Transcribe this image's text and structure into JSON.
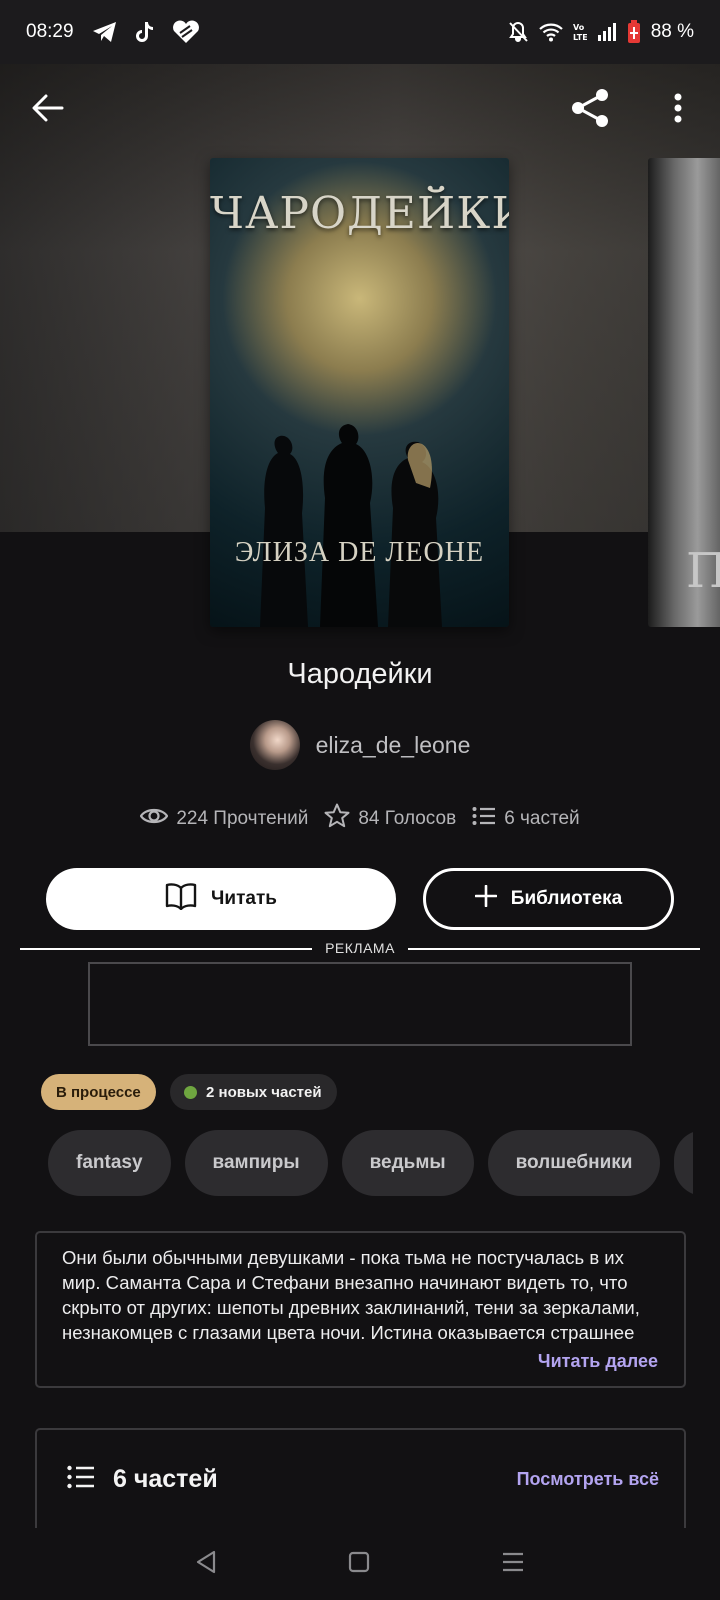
{
  "status_bar": {
    "time": "08:29",
    "battery": "88 %",
    "icons": [
      "telegram-icon",
      "tiktok-icon",
      "heart-icon",
      "mute-icon",
      "wifi-icon",
      "volte-icon",
      "signal-icon",
      "battery-icon"
    ]
  },
  "header": {
    "back_icon": "arrow-back-icon",
    "share_icon": "share-icon",
    "menu_icon": "more-vert-icon"
  },
  "cover": {
    "title": "ЧАРОДЕЙКИ",
    "author": "ЭЛИЗА DE ЛЕОНЕ",
    "next_letter": "П"
  },
  "book": {
    "title": "Чародейки",
    "author": "eliza_de_leone"
  },
  "stats": {
    "reads": "224 Прочтений",
    "votes": "84 Голосов",
    "parts": "6 частей"
  },
  "actions": {
    "read_label": "Читать",
    "library_label": "Библиотека"
  },
  "ad": {
    "label": "РЕКЛАМА"
  },
  "badges": {
    "status": "В процессе",
    "new_parts": "2 новых частей"
  },
  "tags": [
    "fantasy",
    "вампиры",
    "ведьмы",
    "волшебники"
  ],
  "description": {
    "text": "Они были обычными девушками - пока тьма не постучалась в их мир. Саманта Сара и Стефани внезапно начинают видеть то, что скрыто от других: шепоты древних заклинаний, тени за зеркалами, незнакомцев с глазами цвета ночи. Истина оказывается страшнее",
    "read_more": "Читать далее"
  },
  "parts_card": {
    "title": "6 частей",
    "see_all": "Посмотреть всё"
  },
  "colors": {
    "background": "#121113",
    "accent": "#b3a4f0",
    "status_badge": "#d6b279",
    "new_dot": "#6fa640"
  }
}
